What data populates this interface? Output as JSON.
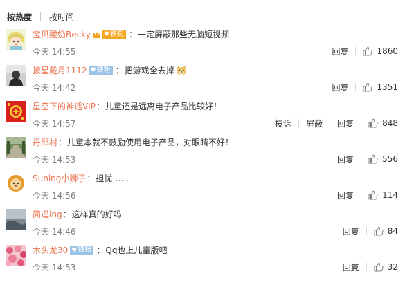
{
  "sort": {
    "hot_label": "按热度",
    "time_label": "按时间"
  },
  "comments": [
    {
      "user": "宝贝酸奶Becky",
      "badge": "铁粉",
      "badge_type": "vip",
      "text": "一定屏蔽那些无脑短视频",
      "emoji": "",
      "time": "今天 14:55",
      "actions": [
        "回复"
      ],
      "likes": "1860"
    },
    {
      "user": "披星戴月1112",
      "badge": "铁粉",
      "badge_type": "fan",
      "text": "把游戏全去掉",
      "emoji": "doge-emoji",
      "time": "今天 14:42",
      "actions": [
        "回复"
      ],
      "likes": "1351"
    },
    {
      "user": "星空下的神话VIP",
      "badge": "",
      "badge_type": "",
      "text": "儿童还是远离电子产品比较好！",
      "emoji": "",
      "time": "今天 14:57",
      "actions": [
        "投诉",
        "屏蔽",
        "回复"
      ],
      "likes": "848"
    },
    {
      "user": "丹邱村",
      "badge": "",
      "badge_type": "",
      "text": "儿童本就不鼓励使用电子产品，对眼睛不好！",
      "emoji": "",
      "time": "今天 14:53",
      "actions": [
        "回复"
      ],
      "likes": "556"
    },
    {
      "user": "Suning小狮子",
      "badge": "",
      "badge_type": "",
      "text": "担忧……",
      "emoji": "",
      "time": "今天 14:56",
      "actions": [
        "回复"
      ],
      "likes": "114"
    },
    {
      "user": "简逕ing",
      "badge": "",
      "badge_type": "",
      "text": "这样真的好吗",
      "emoji": "",
      "time": "今天 14:46",
      "actions": [
        "回复"
      ],
      "likes": "84"
    },
    {
      "user": "木头龙30",
      "badge": "铁粉",
      "badge_type": "fan",
      "text": "Qq也上儿童版吧",
      "emoji": "",
      "time": "今天 14:53",
      "actions": [
        "回复"
      ],
      "likes": "32"
    }
  ],
  "colors": {
    "username": "#eb7350",
    "time": "#808080",
    "fan_badge": "#9ac3e8",
    "vip_badge": "#f6a623"
  },
  "icons": {
    "like": "thumb-up-icon",
    "fan_badge": "heart-icon",
    "vip": "crown-icon"
  }
}
